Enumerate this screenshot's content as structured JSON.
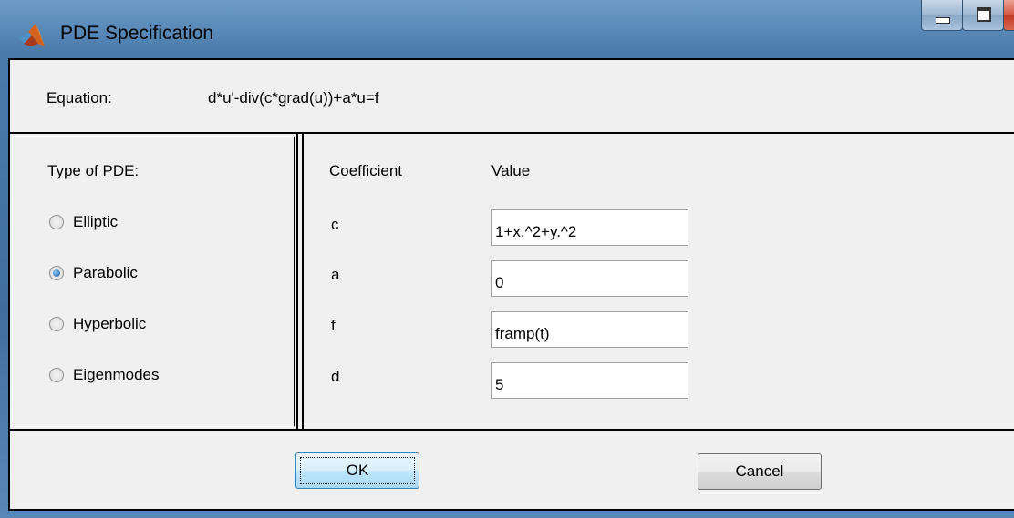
{
  "window": {
    "title": "PDE Specification"
  },
  "equation": {
    "label": "Equation:",
    "value": "d*u'-div(c*grad(u))+a*u=f"
  },
  "pde_type": {
    "title": "Type of PDE:",
    "options": [
      "Elliptic",
      "Parabolic",
      "Hyperbolic",
      "Eigenmodes"
    ],
    "selected": "Parabolic"
  },
  "coefficients": {
    "header_name": "Coefficient",
    "header_value": "Value",
    "rows": [
      {
        "name": "c",
        "value": "1+x.^2+y.^2"
      },
      {
        "name": "a",
        "value": "0"
      },
      {
        "name": "f",
        "value": "framp(t)"
      },
      {
        "name": "d",
        "value": "5"
      }
    ]
  },
  "buttons": {
    "ok": "OK",
    "cancel": "Cancel"
  },
  "icons": {
    "app": "matlab-logo-icon",
    "minimize": "minimize-icon",
    "maximize": "maximize-icon",
    "close": "close-icon"
  }
}
